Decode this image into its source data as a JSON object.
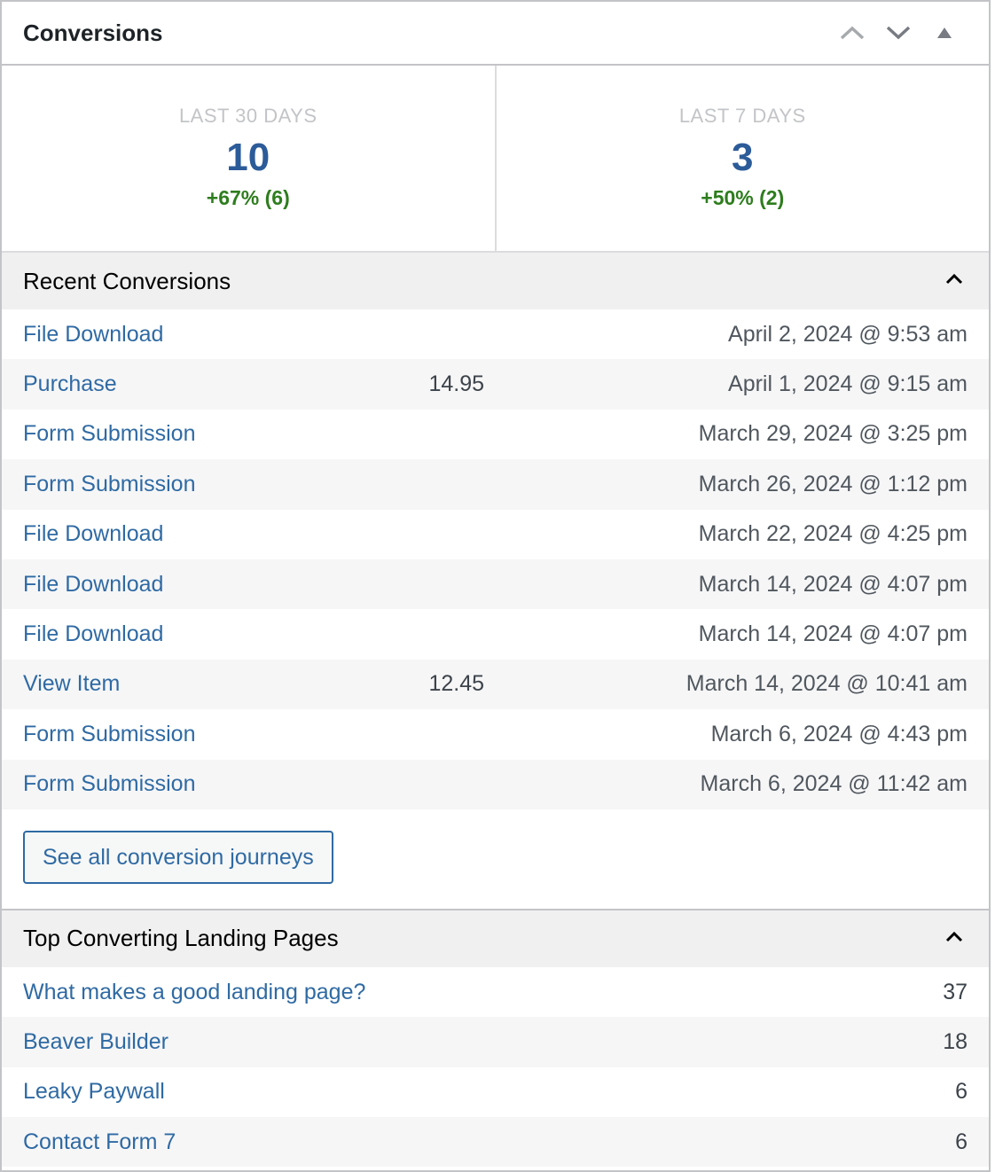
{
  "widget": {
    "title": "Conversions",
    "actions": [
      {
        "name": "move-up-icon",
        "label": "Move up"
      },
      {
        "name": "move-down-icon",
        "label": "Move down"
      },
      {
        "name": "toggle-panel-icon",
        "label": "Toggle panel"
      }
    ]
  },
  "stats": [
    {
      "label": "LAST 30 DAYS",
      "value": "10",
      "change": "+67% (6)"
    },
    {
      "label": "LAST 7 DAYS",
      "value": "3",
      "change": "+50% (2)"
    }
  ],
  "colors": {
    "accent": "#2c5b99",
    "link": "#2f6aa3",
    "positive": "#2e7d1e",
    "muted": "#c3c4c7"
  },
  "recent": {
    "title": "Recent Conversions",
    "rows": [
      {
        "type": "File Download",
        "amount": "",
        "date": "April 2, 2024 @ 9:53 am"
      },
      {
        "type": "Purchase",
        "amount": "14.95",
        "date": "April 1, 2024 @ 9:15 am"
      },
      {
        "type": "Form Submission",
        "amount": "",
        "date": "March 29, 2024 @ 3:25 pm"
      },
      {
        "type": "Form Submission",
        "amount": "",
        "date": "March 26, 2024 @ 1:12 pm"
      },
      {
        "type": "File Download",
        "amount": "",
        "date": "March 22, 2024 @ 4:25 pm"
      },
      {
        "type": "File Download",
        "amount": "",
        "date": "March 14, 2024 @ 4:07 pm"
      },
      {
        "type": "File Download",
        "amount": "",
        "date": "March 14, 2024 @ 4:07 pm"
      },
      {
        "type": "View Item",
        "amount": "12.45",
        "date": "March 14, 2024 @ 10:41 am"
      },
      {
        "type": "Form Submission",
        "amount": "",
        "date": "March 6, 2024 @ 4:43 pm"
      },
      {
        "type": "Form Submission",
        "amount": "",
        "date": "March 6, 2024 @ 11:42 am"
      }
    ],
    "button_label": "See all conversion journeys"
  },
  "landing": {
    "title": "Top Converting Landing Pages",
    "rows": [
      {
        "page": "What makes a good landing page?",
        "count": "37"
      },
      {
        "page": "Beaver Builder",
        "count": "18"
      },
      {
        "page": "Leaky Paywall",
        "count": "6"
      },
      {
        "page": "Contact Form 7",
        "count": "6"
      }
    ]
  }
}
